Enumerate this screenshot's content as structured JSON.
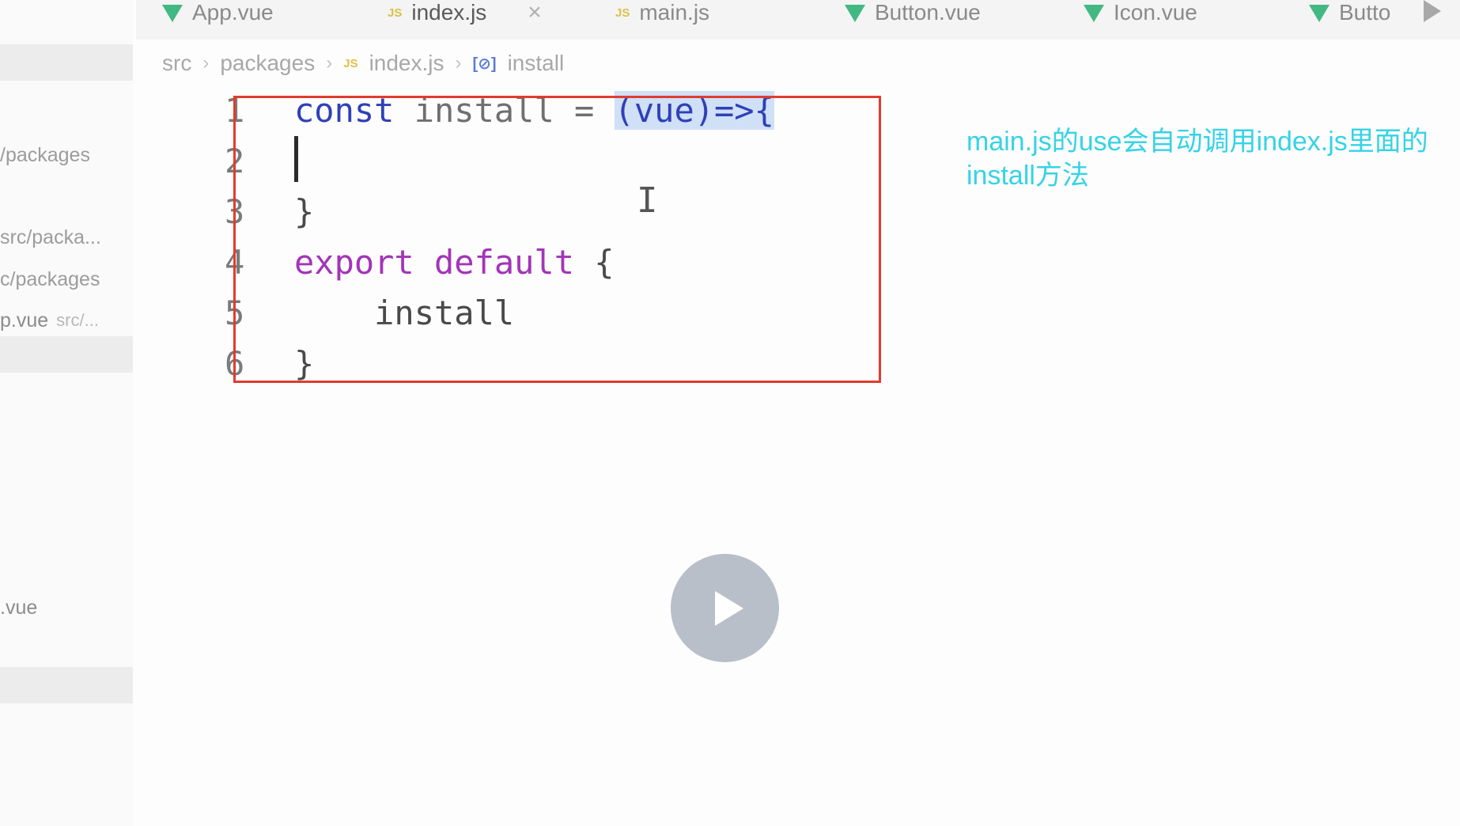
{
  "tabs": [
    {
      "label": "App.vue",
      "icon": "vue-icon"
    },
    {
      "label": "index.js",
      "icon": "js-icon",
      "close": "×"
    },
    {
      "label": "main.js",
      "icon": "js-icon"
    },
    {
      "label": "Button.vue",
      "icon": "vue-icon"
    },
    {
      "label": "Icon.vue",
      "icon": "vue-icon"
    },
    {
      "label": "Butto",
      "icon": "vue-icon"
    }
  ],
  "js_badge": "JS",
  "breadcrumb": {
    "src": "src",
    "packages": "packages",
    "file": "index.js",
    "symbol_icon": "[⊘]",
    "symbol": "install",
    "sep": "›"
  },
  "sidebar": {
    "rows": [
      {
        "main": "/packages",
        "sub": ""
      },
      {
        "main": "src/packa...",
        "sub": ""
      },
      {
        "main": "c/packages",
        "sub": ""
      },
      {
        "main": "p.vue",
        "sub": "src/..."
      },
      {
        "main": ".vue",
        "sub": ""
      }
    ]
  },
  "code": {
    "line_numbers": [
      "1",
      "2",
      "3",
      "4",
      "5",
      "6"
    ],
    "l1_kw": "const",
    "l1_ident": " install = ",
    "l1_param": "(vue)=>{",
    "l3": "}",
    "l4_kw": "export default",
    "l4_rest": " {",
    "l5": "    install",
    "l6": "}",
    "ibeam": "I"
  },
  "annotation": "main.js的use会自动调用index.js里面的install方法",
  "colors": {
    "annotation": "#35d3e6",
    "highlight_box": "#e03c2f",
    "keyword_blue": "#2f40b8",
    "keyword_purple": "#a334b8",
    "vue_icon": "#42b883"
  },
  "play_button": "play-icon"
}
